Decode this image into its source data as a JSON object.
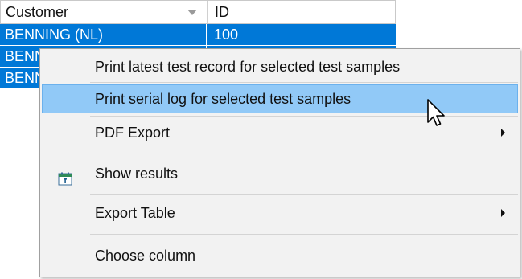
{
  "grid": {
    "columns": [
      "Customer",
      "ID"
    ],
    "rows": [
      {
        "customer": "BENNING (NL)",
        "id": "100"
      },
      {
        "customer": "BENNING",
        "id": ""
      },
      {
        "customer": "BENNING",
        "id": ""
      }
    ],
    "selection_color": "#0078d7"
  },
  "context_menu": {
    "items": [
      {
        "label": "Print latest test record for selected test samples",
        "icon": null,
        "submenu": false
      },
      {
        "label": "Print serial log for selected test samples",
        "icon": null,
        "submenu": false,
        "highlighted": true
      },
      {
        "label": "PDF Export",
        "icon": null,
        "submenu": true
      },
      {
        "label": "Show results",
        "icon": "calendar-icon",
        "submenu": false
      },
      {
        "label": "Export Table",
        "icon": null,
        "submenu": true
      },
      {
        "label": "Choose column",
        "icon": null,
        "submenu": false
      }
    ],
    "highlight_color": "#91c9f7"
  },
  "cursor": {
    "icon": "mouse-pointer-icon"
  }
}
